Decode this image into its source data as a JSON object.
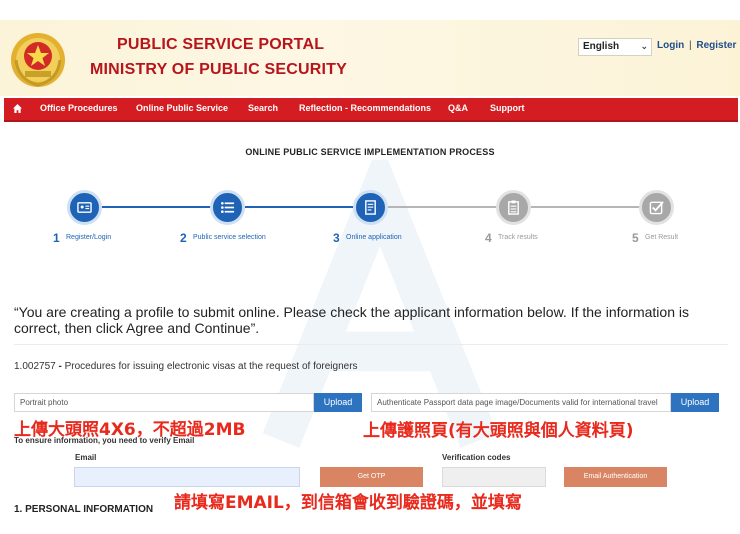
{
  "header": {
    "title_line1": "PUBLIC SERVICE PORTAL",
    "title_line2": "MINISTRY OF PUBLIC SECURITY",
    "language": "English",
    "login": "Login",
    "separator": "|",
    "register": "Register",
    "brand_color": "#b8141b"
  },
  "nav": {
    "items": [
      "Office Procedures",
      "Online Public Service",
      "Search",
      "Reflection - Recommendations",
      "Q&A",
      "Support"
    ],
    "bar_color": "#d41d22"
  },
  "process": {
    "title": "ONLINE PUBLIC SERVICE IMPLEMENTATION PROCESS",
    "steps": [
      {
        "num": "1",
        "label": "Register/Login",
        "status": "active",
        "icon": "id-card-icon"
      },
      {
        "num": "2",
        "label": "Public service selection",
        "status": "active",
        "icon": "list-icon"
      },
      {
        "num": "3",
        "label": "Online application",
        "status": "active",
        "icon": "form-icon"
      },
      {
        "num": "4",
        "label": "Track results",
        "status": "inactive",
        "icon": "clipboard-icon"
      },
      {
        "num": "5",
        "label": "Get Result",
        "status": "inactive",
        "icon": "checkbox-icon"
      }
    ],
    "active_color": "#1e63b5",
    "inactive_color": "#a8a8a8"
  },
  "notice": "“You are creating a profile to submit online. Please check the applicant information below. If the information is correct, then click Agree and Continue”.",
  "procedure": {
    "code": "1.002757",
    "separator": " - ",
    "name": "Procedures for issuing electronic visas at the request of foreigners"
  },
  "uploads": {
    "portrait_placeholder": "Portrait photo",
    "portrait_button": "Upload",
    "passport_placeholder": "Authenticate Passport data page image/Documents valid for international travel",
    "passport_button": "Upload"
  },
  "annotations": {
    "portrait_note": "上傳大頭照4X6，不超過2MB",
    "passport_note": "上傳護照頁(有大頭照與個人資料頁)",
    "email_note": "請填寫EMAIL，到信箱會收到驗證碼，並填寫"
  },
  "verify": {
    "instruction": "To ensure information, you need to verify Email",
    "email_label": "Email",
    "get_otp": "Get OTP",
    "code_label": "Verification codes",
    "auth_button": "Email Authentication"
  },
  "section": {
    "personal_info": "1. PERSONAL INFORMATION"
  }
}
